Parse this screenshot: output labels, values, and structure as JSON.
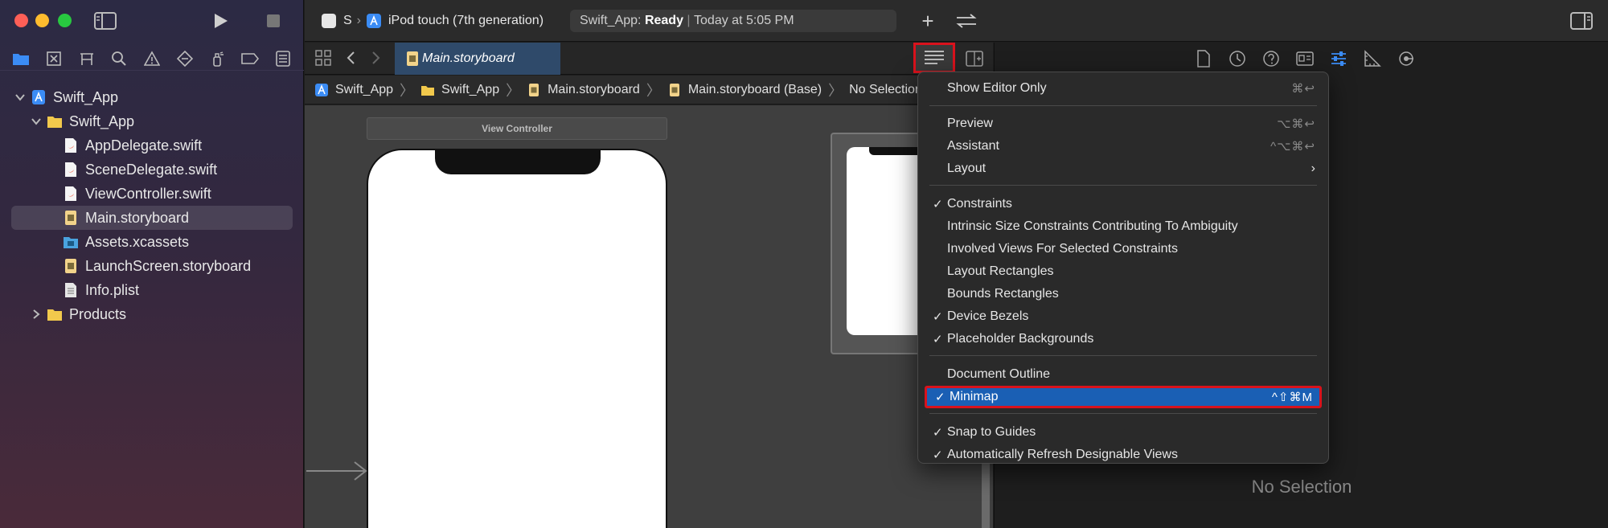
{
  "window": {
    "scheme_short": "S",
    "device": "iPod touch (7th generation)",
    "status_app": "Swift_App:",
    "status_state": "Ready",
    "status_time": "Today at 5:05 PM"
  },
  "tab": {
    "label": "Main.storyboard"
  },
  "navigator": {
    "items": [
      {
        "label": "Swift_App",
        "level": 0,
        "expanded": true,
        "icon": "project-icon"
      },
      {
        "label": "Swift_App",
        "level": 1,
        "expanded": true,
        "icon": "folder-icon"
      },
      {
        "label": "AppDelegate.swift",
        "level": 2,
        "icon": "swift-file-icon"
      },
      {
        "label": "SceneDelegate.swift",
        "level": 2,
        "icon": "swift-file-icon"
      },
      {
        "label": "ViewController.swift",
        "level": 2,
        "icon": "swift-file-icon"
      },
      {
        "label": "Main.storyboard",
        "level": 2,
        "icon": "storyboard-icon",
        "selected": true
      },
      {
        "label": "Assets.xcassets",
        "level": 2,
        "icon": "assets-icon"
      },
      {
        "label": "LaunchScreen.storyboard",
        "level": 2,
        "icon": "storyboard-icon"
      },
      {
        "label": "Info.plist",
        "level": 2,
        "icon": "plist-icon"
      },
      {
        "label": "Products",
        "level": 1,
        "expanded": false,
        "icon": "folder-icon"
      }
    ]
  },
  "breadcrumb": {
    "items": [
      "Swift_App",
      "Swift_App",
      "Main.storyboard",
      "Main.storyboard (Base)",
      "No Selection"
    ]
  },
  "canvas": {
    "scene_title": "View Controller"
  },
  "inspector": {
    "empty_text": "No Selection"
  },
  "menu": {
    "items": [
      {
        "label": "Show Editor Only",
        "shortcut": "⌘↩",
        "checked": false
      },
      {
        "label": "Preview",
        "shortcut": "⌥⌘↩",
        "checked": false
      },
      {
        "label": "Assistant",
        "shortcut": "^⌥⌘↩",
        "checked": false
      },
      {
        "label": "Layout",
        "submenu": true,
        "checked": false
      },
      {
        "label": "Constraints",
        "checked": true
      },
      {
        "label": "Intrinsic Size Constraints Contributing To Ambiguity",
        "checked": false
      },
      {
        "label": "Involved Views For Selected Constraints",
        "checked": false
      },
      {
        "label": "Layout Rectangles",
        "checked": false
      },
      {
        "label": "Bounds Rectangles",
        "checked": false
      },
      {
        "label": "Device Bezels",
        "checked": true
      },
      {
        "label": "Placeholder Backgrounds",
        "checked": true
      },
      {
        "label": "Document Outline",
        "checked": false
      },
      {
        "label": "Minimap",
        "shortcut": "^⇧⌘M",
        "checked": true,
        "highlighted": true
      },
      {
        "label": "Snap to Guides",
        "checked": true
      },
      {
        "label": "Automatically Refresh Designable Views",
        "checked": true
      }
    ],
    "check_glyph": "✓",
    "submenu_glyph": "›"
  },
  "colors": {
    "accent": "#1a5fb4",
    "highlight_border": "#d9121c",
    "swift": "#f05138",
    "folder": "#f2c94c"
  }
}
